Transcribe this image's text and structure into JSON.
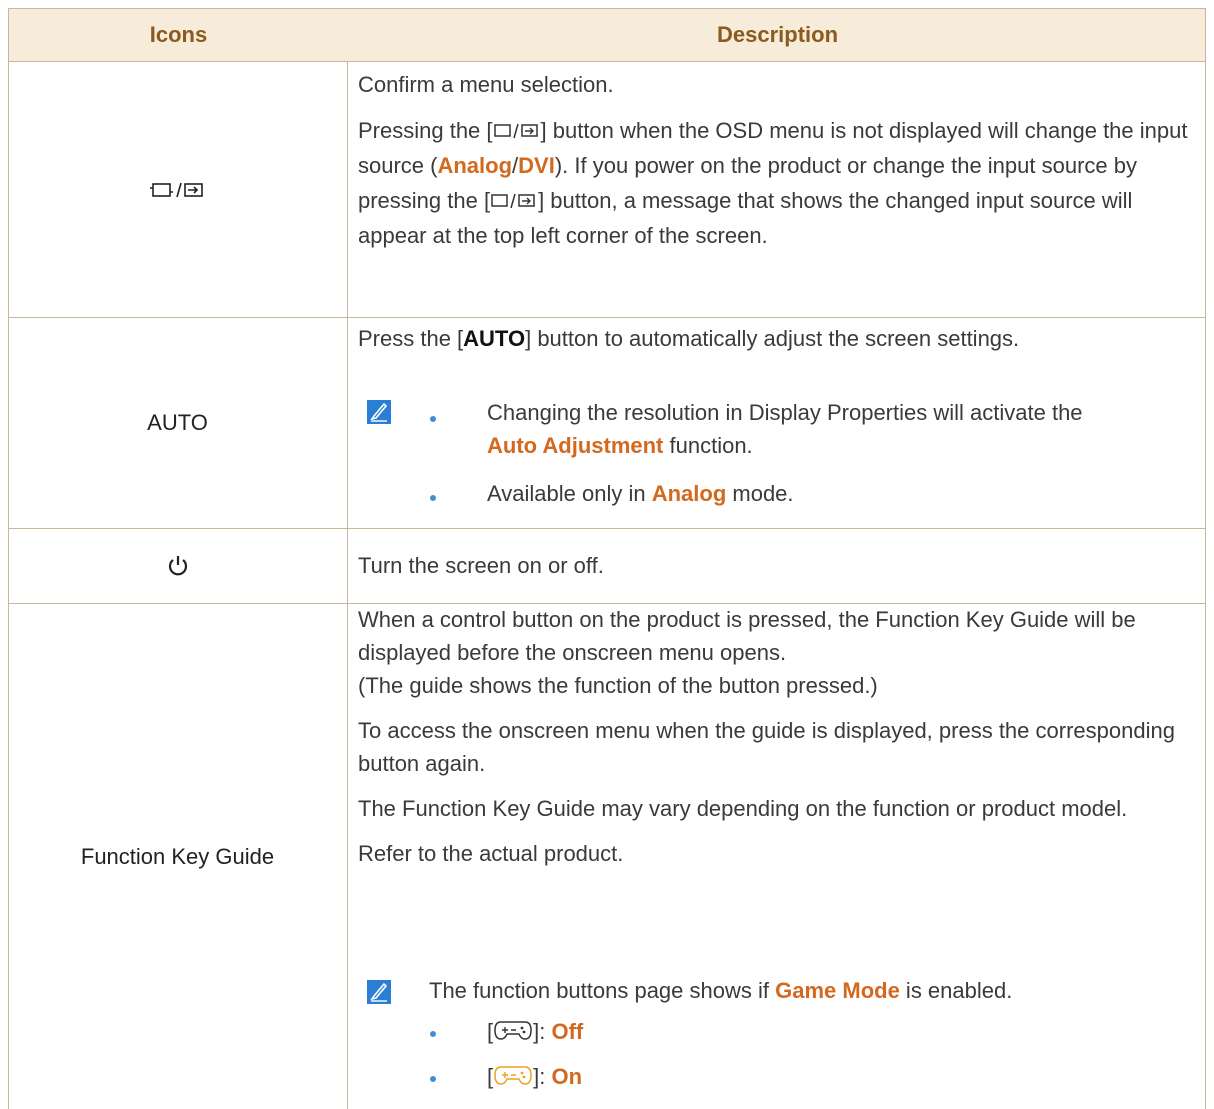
{
  "header": {
    "icons": "Icons",
    "description": "Description"
  },
  "rows": {
    "source": {
      "desc1": "Confirm a menu selection.",
      "desc2a": "Pressing the [",
      "desc2b": "] button when the OSD menu is not displayed will change the input source (",
      "analog": "Analog",
      "slash": "/",
      "dvi": "DVI",
      "desc2c": "). If you power on the product or change the input source by pressing the [",
      "desc2d": "] button, a message that shows the changed input source will appear at the top left corner of the screen."
    },
    "auto": {
      "icon_label": "AUTO",
      "desc1a": "Press the [",
      "desc1b": "AUTO",
      "desc1c": "] button to automatically adjust the screen settings.",
      "bullet1a": "Changing the resolution in Display Properties will activate the",
      "bullet1b": "Auto Adjustment",
      "bullet1c": " function.",
      "bullet2a": "Available only in ",
      "bullet2b": "Analog",
      "bullet2c": " mode."
    },
    "power": {
      "desc": "Turn the screen on or off."
    },
    "fkg": {
      "icon_label": "Function Key Guide",
      "p1": "When a control button on the product is pressed, the Function Key Guide will be displayed before the onscreen menu opens.",
      "p1b": "(The guide shows the function of the button pressed.)",
      "p2": "To access the onscreen menu when the guide is displayed, press the corresponding button again.",
      "p3": "The Function Key Guide may vary depending on the function or product model.",
      "p4": "Refer to the actual product.",
      "note_a": "The function buttons page shows if ",
      "note_b": "Game Mode",
      "note_c": " is enabled.",
      "off_label": "Off",
      "on_label": "On",
      "bracket_open": "[",
      "bracket_close": "]: "
    }
  },
  "colors": {
    "accent": "#d2691e",
    "header_bg": "#f7ecd9",
    "border": "#c9b79c",
    "bullet": "#3e8fd6",
    "note_icon": "#2a7fd4"
  },
  "icons": {
    "source": "source-enter-icon",
    "power": "power-icon",
    "note": "note-pencil-icon",
    "gamepad": "gamepad-icon"
  }
}
